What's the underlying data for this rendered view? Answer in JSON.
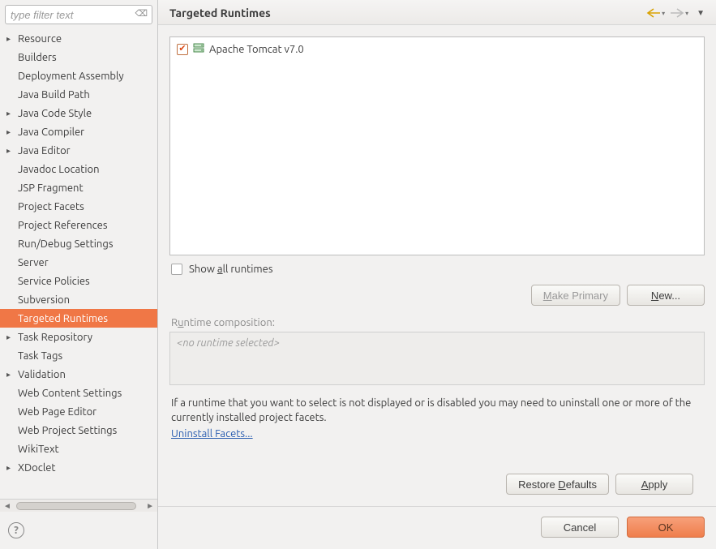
{
  "filter": {
    "placeholder": "type filter text"
  },
  "tree": {
    "items": [
      {
        "label": "Resource",
        "expandable": true
      },
      {
        "label": "Builders",
        "expandable": false
      },
      {
        "label": "Deployment Assembly",
        "expandable": false
      },
      {
        "label": "Java Build Path",
        "expandable": false
      },
      {
        "label": "Java Code Style",
        "expandable": true
      },
      {
        "label": "Java Compiler",
        "expandable": true
      },
      {
        "label": "Java Editor",
        "expandable": true
      },
      {
        "label": "Javadoc Location",
        "expandable": false
      },
      {
        "label": "JSP Fragment",
        "expandable": false
      },
      {
        "label": "Project Facets",
        "expandable": false
      },
      {
        "label": "Project References",
        "expandable": false
      },
      {
        "label": "Run/Debug Settings",
        "expandable": false
      },
      {
        "label": "Server",
        "expandable": false
      },
      {
        "label": "Service Policies",
        "expandable": false
      },
      {
        "label": "Subversion",
        "expandable": false
      },
      {
        "label": "Targeted Runtimes",
        "expandable": false,
        "selected": true
      },
      {
        "label": "Task Repository",
        "expandable": true
      },
      {
        "label": "Task Tags",
        "expandable": false
      },
      {
        "label": "Validation",
        "expandable": true
      },
      {
        "label": "Web Content Settings",
        "expandable": false
      },
      {
        "label": "Web Page Editor",
        "expandable": false
      },
      {
        "label": "Web Project Settings",
        "expandable": false
      },
      {
        "label": "WikiText",
        "expandable": false
      },
      {
        "label": "XDoclet",
        "expandable": true
      }
    ]
  },
  "header": {
    "title": "Targeted Runtimes"
  },
  "runtimes": [
    {
      "label": "Apache Tomcat v7.0",
      "checked": true
    }
  ],
  "showAll": {
    "label_pre": "Show ",
    "label_u": "a",
    "label_post": "ll runtimes",
    "checked": false
  },
  "buttons": {
    "makePrimary_pre": "",
    "makePrimary_u": "M",
    "makePrimary_post": "ake Primary",
    "new_pre": "",
    "new_u": "N",
    "new_post": "ew...",
    "restore_pre": "Restore ",
    "restore_u": "D",
    "restore_post": "efaults",
    "apply_pre": "",
    "apply_u": "A",
    "apply_post": "pply",
    "cancel": "Cancel",
    "ok": "OK"
  },
  "composition": {
    "label_pre": "R",
    "label_u": "u",
    "label_post": "ntime composition:",
    "placeholder": "<no runtime selected>"
  },
  "info": {
    "text": "If a runtime that you want to select is not displayed or is disabled you may need to uninstall one or more of the currently installed project facets.",
    "link": "Uninstall Facets..."
  }
}
